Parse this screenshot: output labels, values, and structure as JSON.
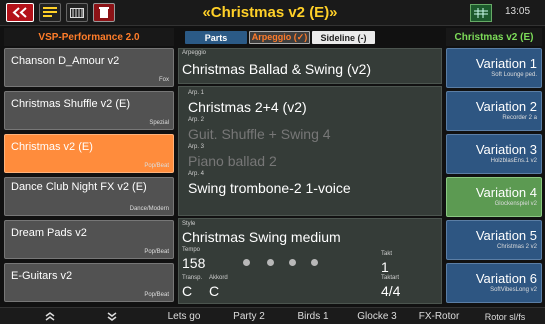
{
  "topbar": {
    "title": "«Christmas v2 (E)»",
    "time": "13:05",
    "icons": [
      "back-icon",
      "menu-list-icon",
      "keyboard-icon",
      "trash-icon",
      "grid-icon"
    ]
  },
  "header": {
    "left": "VSP-Performance 2.0",
    "tabs": [
      "Parts",
      "Arpeggio (✓)",
      "Sideline (-)"
    ],
    "right": "Christmas v2 (E)"
  },
  "left_list": [
    {
      "name": "Chanson D_Amour v2",
      "cat": "Fox"
    },
    {
      "name": "Christmas Shuffle v2 (E)",
      "cat": "Spezial"
    },
    {
      "name": "Christmas v2 (E)",
      "cat": "Pop/Beat"
    },
    {
      "name": "Dance Club Night FX v2 (E)",
      "cat": "Dance/Modern"
    },
    {
      "name": "Dream Pads v2",
      "cat": "Pop/Beat"
    },
    {
      "name": "E-Guitars v2",
      "cat": "Pop/Beat"
    }
  ],
  "arpeggio": {
    "label": "Arpeggio",
    "value": "Christmas Ballad & Swing (v2)",
    "arps": [
      {
        "label": "Arp. 1",
        "value": "Christmas 2+4 (v2)"
      },
      {
        "label": "Arp. 2",
        "value": "Guit. Shuffle + Swing 4"
      },
      {
        "label": "Arp. 3",
        "value": "Piano ballad 2"
      },
      {
        "label": "Arp. 4",
        "value": "Swing trombone-2 1-voice"
      }
    ]
  },
  "style": {
    "label": "Style",
    "value": "Christmas Swing medium",
    "tempo_label": "Tempo",
    "tempo": "158",
    "takt_label": "Takt",
    "takt": "1",
    "transp_label": "Transp.",
    "transp": "C",
    "akkord_label": "Akkord",
    "akkord": "C",
    "taktart_label": "Taktart",
    "taktart": "4/4"
  },
  "variations": [
    {
      "title": "Variation 1",
      "sub": "Soft Lounge ped."
    },
    {
      "title": "Variation 2",
      "sub": "Recorder 2    a"
    },
    {
      "title": "Variation 3",
      "sub": "HolzblasEns.1 v2"
    },
    {
      "title": "Variation 4",
      "sub": "Glockenspiel v2"
    },
    {
      "title": "Variation 5",
      "sub": "Christmas 2 v2"
    },
    {
      "title": "Variation 6",
      "sub": "SoftVibesLong v2"
    }
  ],
  "bottom": [
    "Lets go",
    "Party 2",
    "Birds 1",
    "Glocke 3",
    "FX-Rotor",
    "Rotor sl/fs"
  ]
}
